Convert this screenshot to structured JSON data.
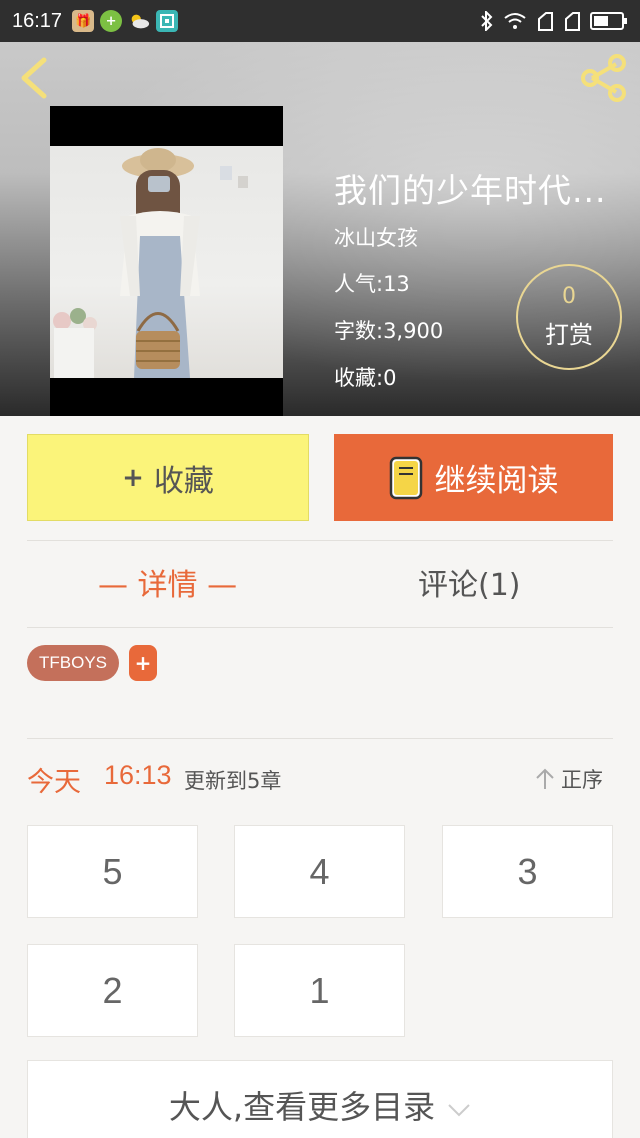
{
  "status_bar": {
    "time": "16:17"
  },
  "book": {
    "title": "我们的少年时代...",
    "author": "冰山女孩",
    "popularity": "人气:13",
    "word_count": "字数:3,900",
    "collections": "收藏:0"
  },
  "reward": {
    "count": "0",
    "label": "打赏"
  },
  "actions": {
    "collect_label": "收藏",
    "read_label": "继续阅读"
  },
  "tabs": {
    "detail": "— 详情 —",
    "comments": "评论(1)"
  },
  "tags": [
    {
      "label": "TFBOYS"
    }
  ],
  "tag_add": "+",
  "update": {
    "day": "今天",
    "time": "16:13",
    "text": "更新到5章",
    "sort_label": "正序"
  },
  "chapters": [
    {
      "label": "5"
    },
    {
      "label": "4"
    },
    {
      "label": "3"
    },
    {
      "label": "2"
    },
    {
      "label": "1"
    }
  ],
  "more_catalog": "大人,查看更多目录",
  "colors": {
    "accent": "#e8693a",
    "collect_button": "#fbf47a",
    "tag": "#c4705b",
    "reward_ring": "#e9d693"
  }
}
